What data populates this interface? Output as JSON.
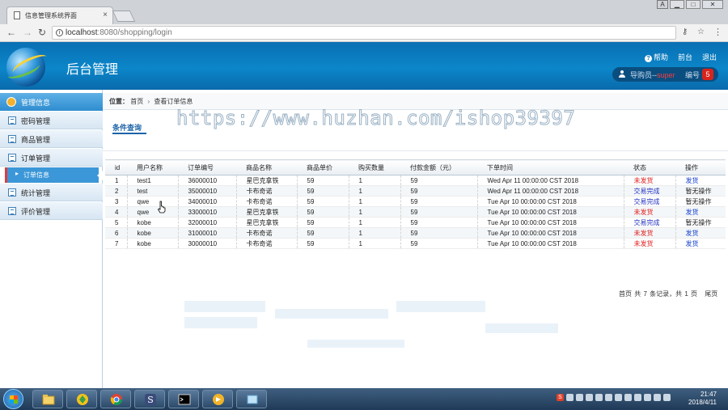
{
  "browser": {
    "tab_title": "信息管理系统界面",
    "tab_close": "×",
    "url_host": "localhost",
    "url_rest": ":8080/shopping/login",
    "win_buttons": [
      "A",
      "▁",
      "□",
      "✕"
    ]
  },
  "header": {
    "brand": "后台管理",
    "help_icon_glyph": "?",
    "help": "帮助",
    "home": "前台",
    "logout": "退出",
    "user_label": "导购员--",
    "user_name": "super",
    "number_label": "编号",
    "number_value": "5"
  },
  "sidebar": {
    "title": "管理信息",
    "items": [
      "密码管理",
      "商品管理",
      "订单管理",
      "统计管理",
      "评价管理"
    ],
    "active_sub": "订单信息"
  },
  "breadcrumb": {
    "label": "位置：",
    "home": "首页",
    "sep": "›",
    "current": "查看订单信息"
  },
  "filter_tab": "条件查询",
  "watermark": "https://www.huzhan.com/ishop39397",
  "table": {
    "columns": [
      "id",
      "用户名称",
      "订单编号",
      "商品名称",
      "商品单价",
      "购买数量",
      "付款金额（元）",
      "下单时间",
      "状态",
      "操作"
    ],
    "rows": [
      [
        "1",
        "test1",
        "36000010",
        "星巴克拿铁",
        "59",
        "1",
        "59",
        "Wed Apr 11 00:00:00 CST 2018",
        "未发货",
        "发货"
      ],
      [
        "2",
        "test",
        "35000010",
        "卡布奇诺",
        "59",
        "1",
        "59",
        "Wed Apr 11 00:00:00 CST 2018",
        "交易完成",
        "暂无操作"
      ],
      [
        "3",
        "qwe",
        "34000010",
        "卡布奇诺",
        "59",
        "1",
        "59",
        "Tue Apr 10 00:00:00 CST 2018",
        "交易完成",
        "暂无操作"
      ],
      [
        "4",
        "qwe",
        "33000010",
        "星巴克拿铁",
        "59",
        "1",
        "59",
        "Tue Apr 10 00:00:00 CST 2018",
        "未发货",
        "发货"
      ],
      [
        "5",
        "kobe",
        "32000010",
        "星巴克拿铁",
        "59",
        "1",
        "59",
        "Tue Apr 10 00:00:00 CST 2018",
        "交易完成",
        "暂无操作"
      ],
      [
        "6",
        "kobe",
        "31000010",
        "卡布奇诺",
        "59",
        "1",
        "59",
        "Tue Apr 10 00:00:00 CST 2018",
        "未发货",
        "发货"
      ],
      [
        "7",
        "kobe",
        "30000010",
        "卡布奇诺",
        "59",
        "1",
        "59",
        "Tue Apr 10 00:00:00 CST 2018",
        "未发货",
        "发货"
      ]
    ]
  },
  "pager": {
    "first": "首页",
    "summary": "共 7 条记录，共 1 页",
    "last": "尾页"
  },
  "taskbar": {
    "time": "21:47",
    "date": "2018/4/11",
    "ime_glyph": "S"
  },
  "colors": {
    "header_blue": "#0b86c9",
    "status_pending": "#e02020",
    "status_done": "#2030c0",
    "badge_red": "#d9241c"
  }
}
